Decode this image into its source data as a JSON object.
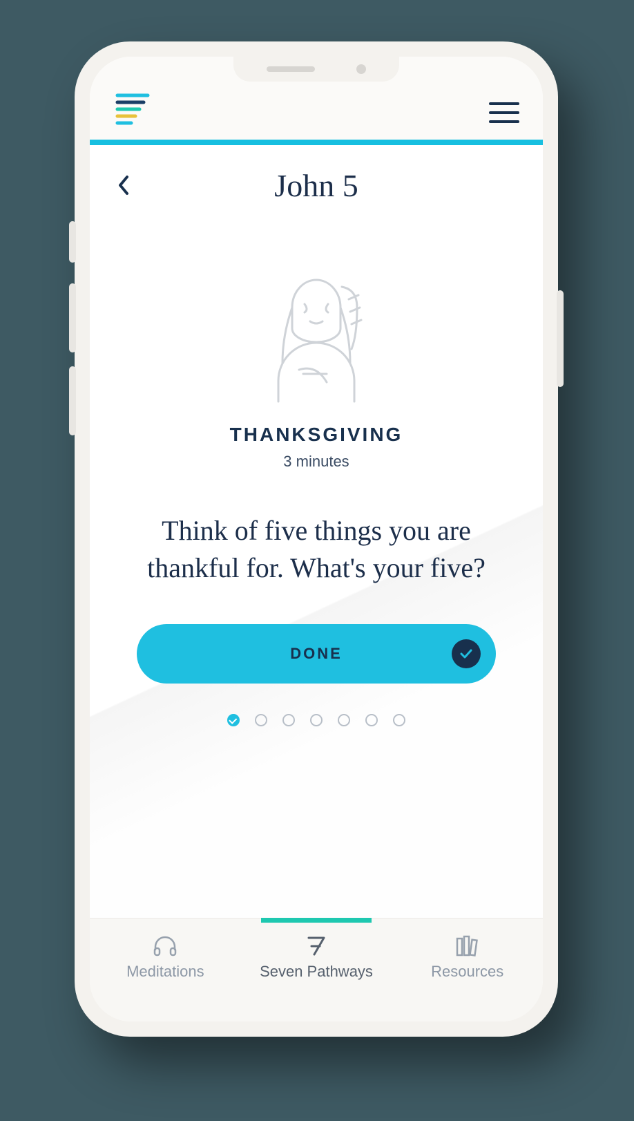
{
  "header": {
    "title": "John 5"
  },
  "card": {
    "kicker": "THANKSGIVING",
    "duration": "3 minutes",
    "prompt": "Think of five things you are thankful for. What's your five?",
    "button_label": "DONE"
  },
  "progress": {
    "total": 7,
    "active_index": 0
  },
  "tabs": [
    {
      "label": "Meditations",
      "active": false
    },
    {
      "label": "Seven Pathways",
      "active": true
    },
    {
      "label": "Resources",
      "active": false
    }
  ],
  "colors": {
    "accent": "#17bfe0",
    "brand_dark": "#18304d",
    "mint": "#1ec8b0"
  }
}
